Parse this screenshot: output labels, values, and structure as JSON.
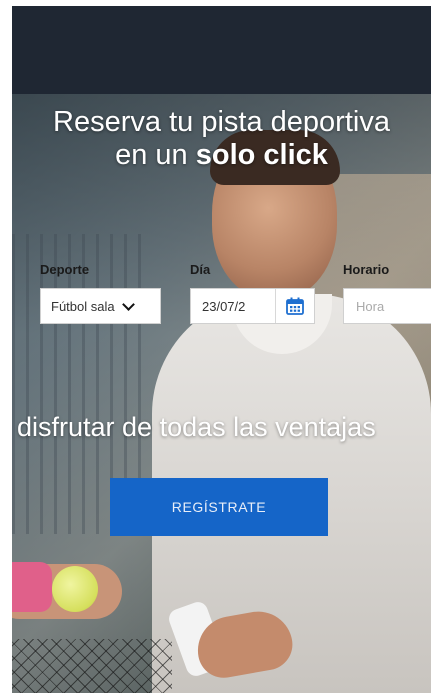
{
  "hero": {
    "headline_line1": "Reserva tu pista deportiva",
    "headline_line2_prefix": "en un ",
    "headline_line2_bold": "solo click"
  },
  "search": {
    "sport_label": "Deporte",
    "sport_value": "Fútbol sala",
    "day_label": "Día",
    "day_value": "23/07/2",
    "time_label": "Horario",
    "time_placeholder": "Hora"
  },
  "benefits_text": "disfrutar de todas las ventajas",
  "register_label": "REGÍSTRATE",
  "icons": {
    "sport_dropdown": "chevron-down-icon",
    "calendar": "calendar-icon"
  },
  "colors": {
    "topbar": "#1f2733",
    "register_button": "#1565c8",
    "calendar_icon": "#1e6fd0"
  }
}
